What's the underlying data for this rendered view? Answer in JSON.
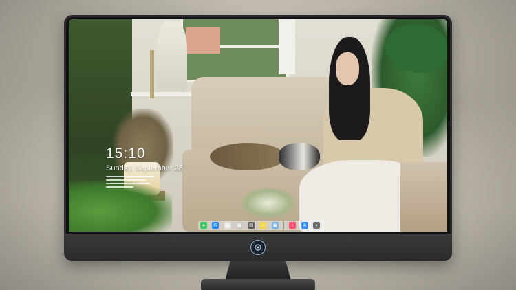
{
  "lockscreen": {
    "time": "15:10",
    "date": "Sunday, September 28"
  },
  "dock": {
    "icons": [
      {
        "name": "messages",
        "color": "#34c759",
        "glyph": "●"
      },
      {
        "name": "mail",
        "color": "#1e88ff",
        "glyph": "✉"
      },
      {
        "name": "chrome",
        "color": "#e8e8e8",
        "glyph": "◉"
      },
      {
        "name": "preview",
        "color": "#c8c8c8",
        "glyph": "▦"
      },
      {
        "name": "launchpad",
        "color": "#5a5a5a",
        "glyph": "▤"
      },
      {
        "name": "notes",
        "color": "#f5d44a",
        "glyph": "▭"
      },
      {
        "name": "photos",
        "color": "#7bb0e8",
        "glyph": "▣"
      },
      {
        "name": "music",
        "color": "#ff4a6e",
        "glyph": "♪"
      },
      {
        "name": "app-store",
        "color": "#2f8cff",
        "glyph": "A"
      },
      {
        "name": "camera",
        "color": "#6e6e6e",
        "glyph": "▪"
      }
    ]
  },
  "colors": {
    "bezel": "#121212",
    "monitor_body": "#2c2c2e",
    "lock_text": "#ffffff"
  }
}
